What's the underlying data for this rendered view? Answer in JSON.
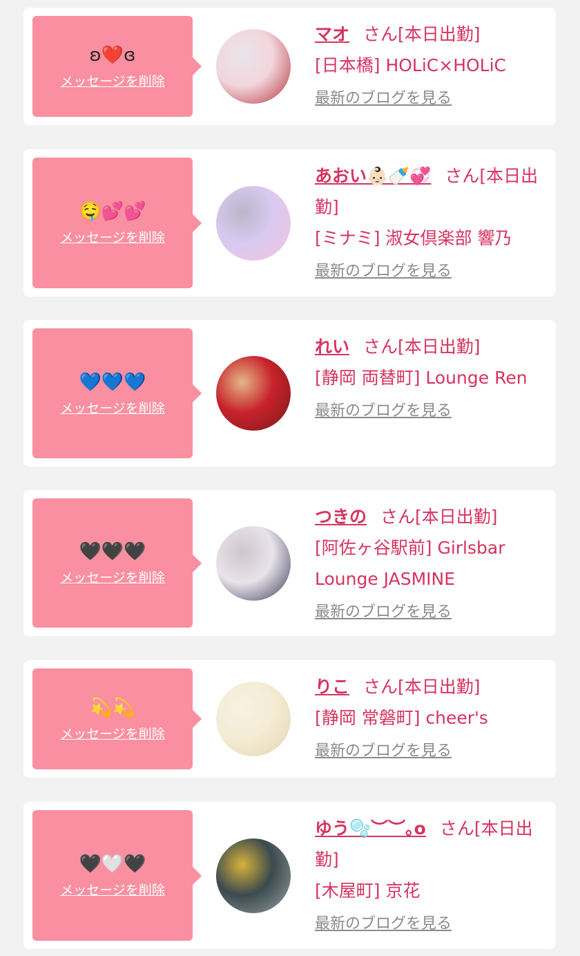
{
  "messages": [
    {
      "emoji": "ʚ❤️ɞ",
      "delete_label": "メッセージを削除",
      "name": "マオ",
      "suffix": "さん[本日出勤]",
      "shop": "[日本橋] HOLiC×HOLiC",
      "blog_label": "最新のブログを見る",
      "avatar_colors": [
        "#f2d6dc",
        "#b4323d",
        "#e9e4ea"
      ]
    },
    {
      "emoji": "🤤💕💕",
      "delete_label": "メッセージを削除",
      "name": "あおい👶🏻🍼💞",
      "suffix": "さん[本日出勤]",
      "shop": "[ミナミ] 淑女倶楽部 響乃",
      "blog_label": "最新のブログを見る",
      "avatar_colors": [
        "#d9c9f0",
        "#f1c5de",
        "#b9b7c9"
      ]
    },
    {
      "emoji": "💙💙💙",
      "delete_label": "メッセージを削除",
      "name": "れい",
      "suffix": "さん[本日出勤]",
      "shop": "[静岡 両替町] Lounge Ren",
      "blog_label": "最新のブログを見る",
      "avatar_colors": [
        "#c8222b",
        "#7a1a1b",
        "#e3b787"
      ]
    },
    {
      "emoji": "🖤🖤🖤",
      "delete_label": "メッセージを削除",
      "name": "つきの",
      "suffix": "さん[本日出勤]",
      "shop": "[阿佐ヶ谷駅前] Girlsbar Lounge JASMINE",
      "blog_label": "最新のブログを見る",
      "avatar_colors": [
        "#e8e3ea",
        "#3a3a55",
        "#cfc6cd"
      ]
    },
    {
      "emoji": "💫💫",
      "delete_label": "メッセージを削除",
      "name": "りこ",
      "suffix": "さん[本日出勤]",
      "shop": "[静岡 常磐町] cheer's",
      "blog_label": "最新のブログを見る",
      "avatar_colors": [
        "#f4ecd4",
        "#e6d6b4",
        "#f7f1e5"
      ]
    },
    {
      "emoji": "🖤🤍🖤",
      "delete_label": "メッセージを削除",
      "name": "ゆう🫧︶︶｡o",
      "suffix": "さん[本日出勤]",
      "shop": "[木屋町] 京花",
      "blog_label": "最新のブログを見る",
      "avatar_colors": [
        "#3b4a4f",
        "#9aa3a2",
        "#d6b23a"
      ]
    }
  ]
}
